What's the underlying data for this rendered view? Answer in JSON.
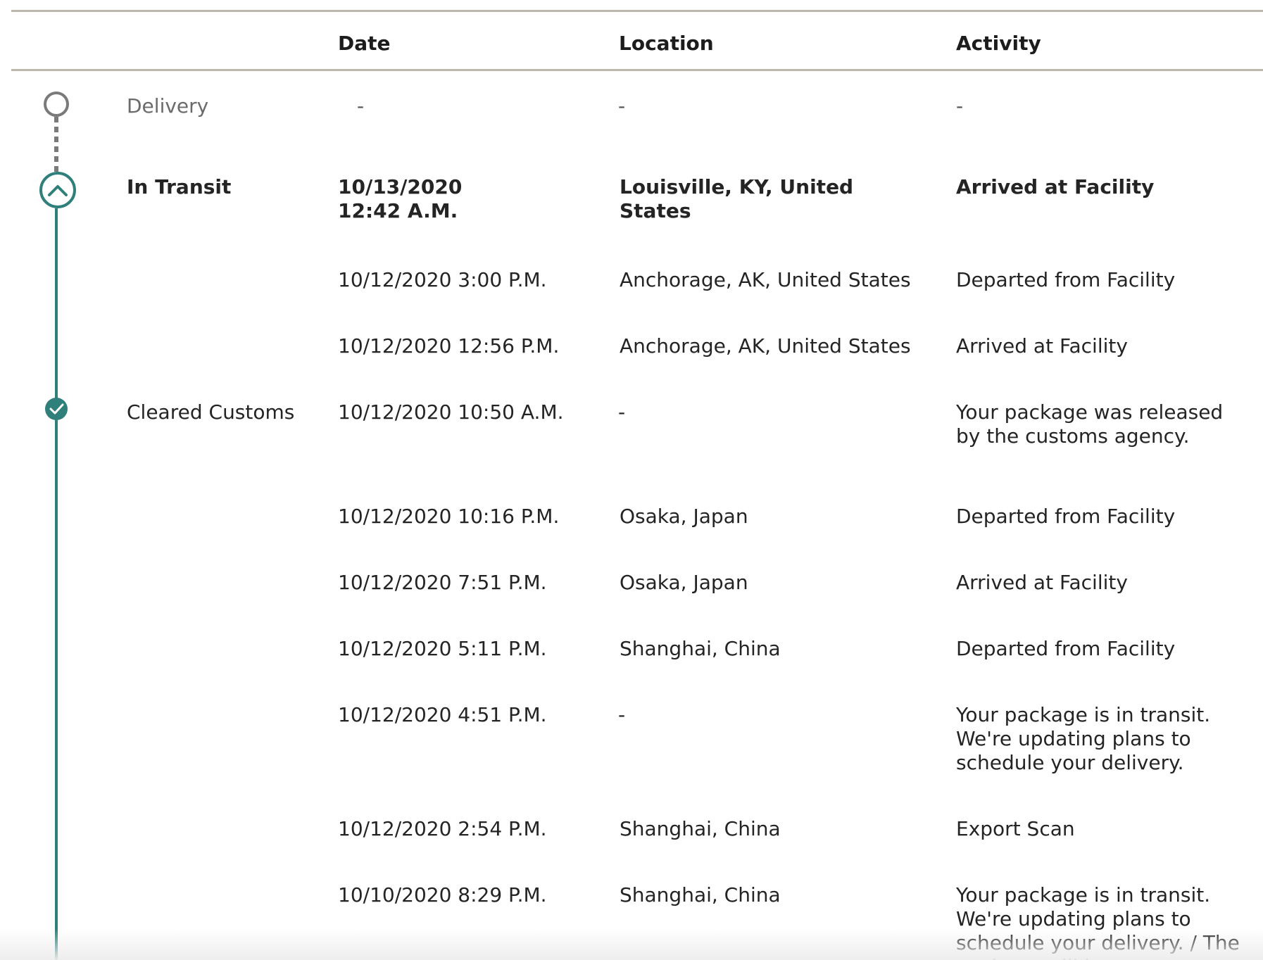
{
  "table": {
    "headers": {
      "date": "Date",
      "location": "Location",
      "activity": "Activity"
    }
  },
  "milestones": [
    {
      "status": "Delivery",
      "date": "-",
      "location": "-",
      "activity": "-",
      "icon": "empty-circle-icon"
    },
    {
      "status": "In Transit",
      "date_line1": "10/13/2020",
      "date_line2": "12:42 A.M.",
      "location": "Louisville, KY, United States",
      "activity": "Arrived at Facility",
      "icon": "chevron-up-icon"
    },
    {
      "status": "Cleared Customs",
      "icon": "checkmark-circle-icon"
    }
  ],
  "events": [
    {
      "date": "10/12/2020  3:00 P.M.",
      "location": "Anchorage, AK, United States",
      "activity": "Departed from Facility"
    },
    {
      "date": "10/12/2020  12:56 P.M.",
      "location": "Anchorage, AK, United States",
      "activity": "Arrived at Facility"
    },
    {
      "date": "10/12/2020  10:50 A.M.",
      "location": "-",
      "activity": "Your package was released by the customs agency."
    },
    {
      "date": "10/12/2020  10:16 P.M.",
      "location": "Osaka, Japan",
      "activity": "Departed from Facility"
    },
    {
      "date": "10/12/2020  7:51 P.M.",
      "location": "Osaka, Japan",
      "activity": "Arrived at Facility"
    },
    {
      "date": "10/12/2020  5:11 P.M.",
      "location": "Shanghai, China",
      "activity": "Departed from Facility"
    },
    {
      "date": "10/12/2020  4:51 P.M.",
      "location": "-",
      "activity": "Your package is in transit. We're updating plans to schedule your delivery."
    },
    {
      "date": "10/12/2020  2:54 P.M.",
      "location": "Shanghai, China",
      "activity": "Export Scan"
    },
    {
      "date": "10/10/2020  8:29 P.M.",
      "location": "Shanghai, China",
      "activity": "Your package is in transit. We're updating plans to schedule your delivery. / The package will be"
    }
  ],
  "colors": {
    "accent": "#2f7f7b",
    "pending_gray": "#7a7a7a",
    "divider": "#bfb8af"
  }
}
